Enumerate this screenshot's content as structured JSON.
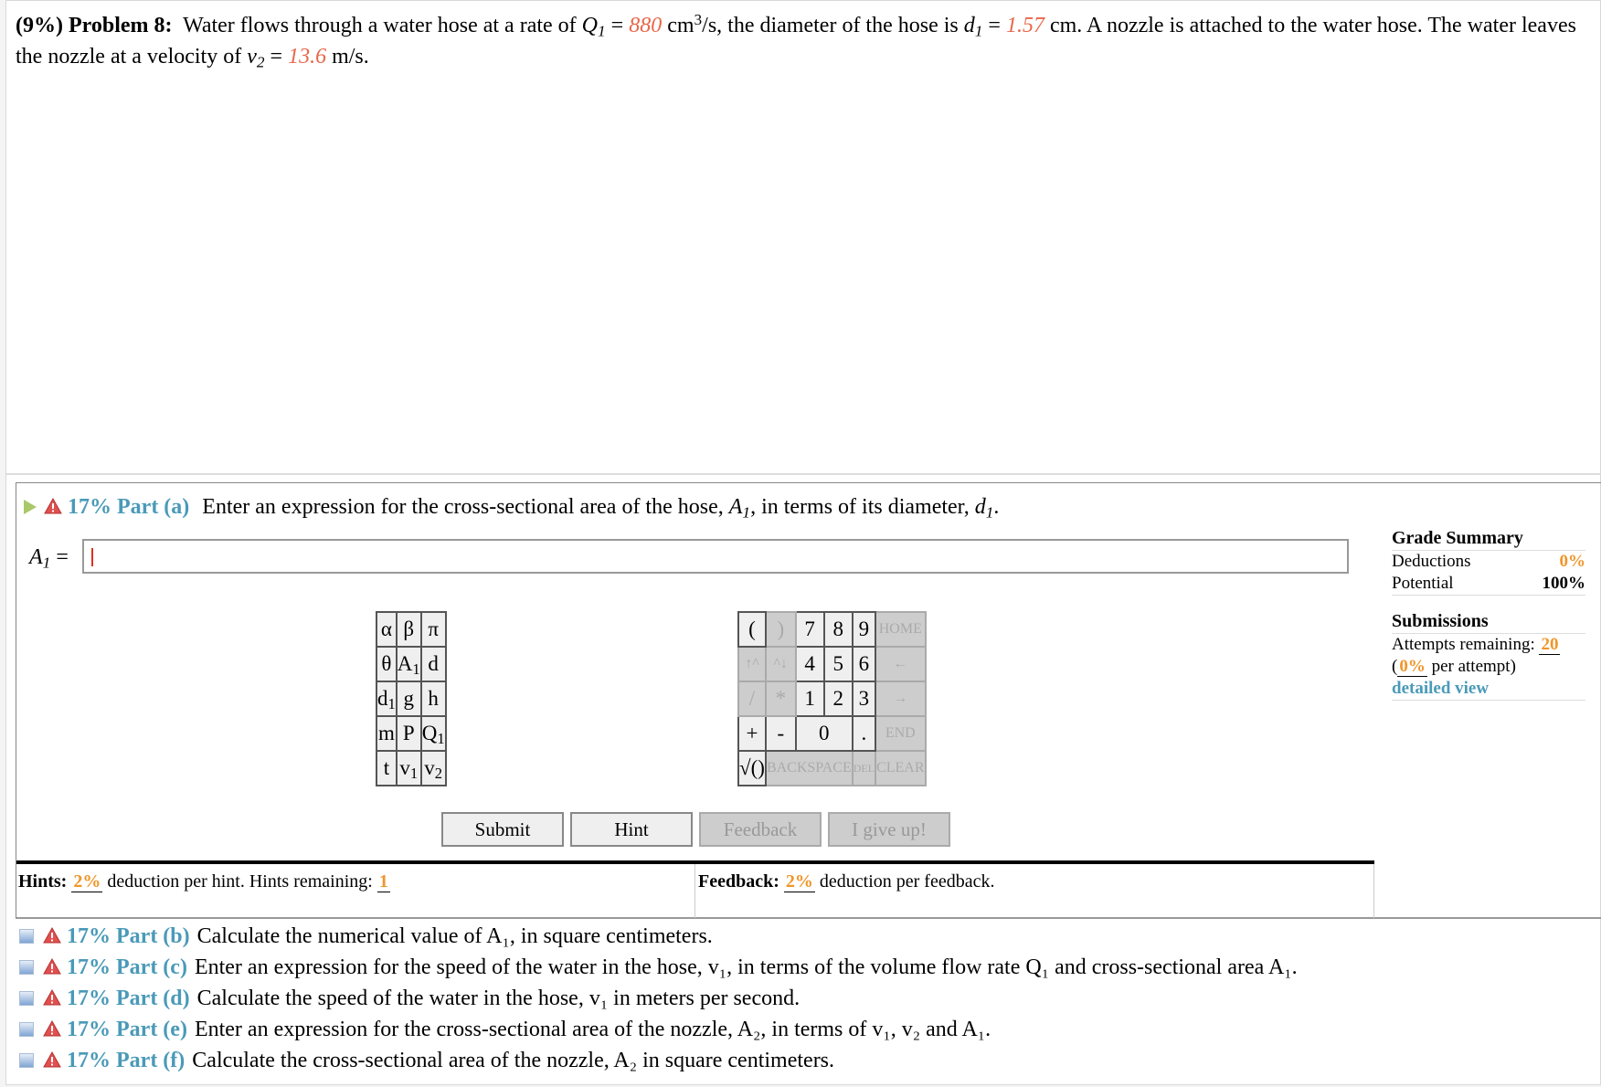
{
  "problem": {
    "weight": "(9%)",
    "title": "Problem 8:",
    "text1": "Water flows through a water hose at a rate of",
    "q_var": "Q",
    "q_sub": "1",
    "eq": "=",
    "q_value": "880",
    "q_unit_pre": "cm",
    "q_unit_sup": "3",
    "q_unit_post": "/s, the diameter of the hose is",
    "d_var": "d",
    "d_sub": "1",
    "d_value": "1.57",
    "text2": "cm. A nozzle is attached to the water hose. The water leaves the nozzle at a velocity of",
    "v_var": "v",
    "v_sub": "2",
    "v_value": "13.6",
    "v_unit": "m/s."
  },
  "part_a": {
    "percent_label": "17% Part (a)",
    "prompt_pre": "Enter an expression for the cross-sectional area of the hose,",
    "prompt_var1": "A",
    "prompt_sub1": "1",
    "prompt_mid": ", in terms of its diameter,",
    "prompt_var2": "d",
    "prompt_sub2": "1",
    "prompt_end": ".",
    "answer_label_var": "A",
    "answer_label_sub": "1",
    "answer_label_eq": "=",
    "answer_value": ""
  },
  "grade_summary": {
    "title": "Grade Summary",
    "deductions_label": "Deductions",
    "deductions_value": "0%",
    "potential_label": "Potential",
    "potential_value": "100%",
    "submissions_title": "Submissions",
    "attempts_label": "Attempts remaining:",
    "attempts_value": "20",
    "per_attempt_open": "(",
    "per_attempt_value": "0%",
    "per_attempt_label": "per attempt)",
    "detailed_view": "detailed view"
  },
  "keypad": {
    "variables": [
      [
        "α",
        "β",
        "π"
      ],
      [
        "θ",
        "A1",
        "d"
      ],
      [
        "d1",
        "g",
        "h"
      ],
      [
        "m",
        "P",
        "Q1"
      ],
      [
        "t",
        "v1",
        "v2"
      ]
    ],
    "keys": {
      "open_paren": "(",
      "close_paren": ")",
      "seven": "7",
      "eight": "8",
      "nine": "9",
      "home": "HOME",
      "up_power": "↑^",
      "down_power": "^↓",
      "four": "4",
      "five": "5",
      "six": "6",
      "left": "←",
      "divide": "/",
      "multiply": "*",
      "one": "1",
      "two": "2",
      "three": "3",
      "right": "→",
      "plus": "+",
      "minus": "-",
      "zero": "0",
      "dot": ".",
      "end": "END",
      "sqrt": "√()",
      "backspace": "BACKSPACE",
      "del": "DEL",
      "clear": "CLEAR"
    }
  },
  "buttons": {
    "submit": "Submit",
    "hint": "Hint",
    "feedback": "Feedback",
    "give_up": "I give up!"
  },
  "hints": {
    "label": "Hints:",
    "deduction_value": "2%",
    "deduction_text": "deduction per hint. Hints remaining:",
    "remaining_value": "1"
  },
  "feedback": {
    "label": "Feedback:",
    "deduction_value": "2%",
    "deduction_text": "deduction per feedback."
  },
  "other_parts": [
    {
      "percent_label": "17% Part (b)",
      "text": "Calculate the numerical value of A₁, in square centimeters."
    },
    {
      "percent_label": "17% Part (c)",
      "text": "Enter an expression for the speed of the water in the hose, v₁, in terms of the volume flow rate Q₁ and cross-sectional area A₁."
    },
    {
      "percent_label": "17% Part (d)",
      "text": "Calculate the speed of the water in the hose, v₁ in meters per second."
    },
    {
      "percent_label": "17% Part (e)",
      "text": "Enter an expression for the cross-sectional area of the nozzle, A₂, in terms of v₁, v₂ and A₁."
    },
    {
      "percent_label": "17% Part (f)",
      "text": "Calculate the cross-sectional area of the nozzle, A₂ in square centimeters."
    }
  ],
  "colors": {
    "given_value": "#e8674a",
    "part_label": "#4a9ab8",
    "orange_highlight": "#f0962a"
  }
}
